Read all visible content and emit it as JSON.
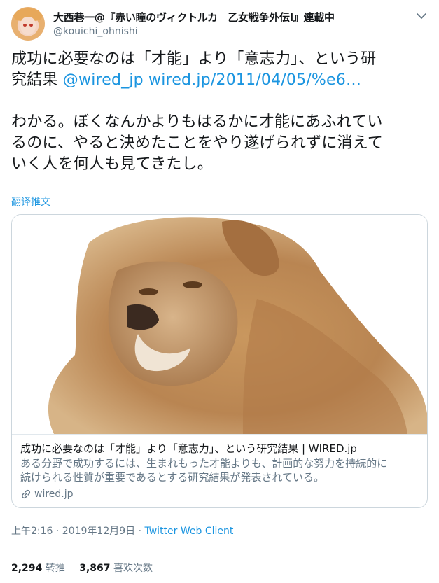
{
  "user": {
    "display_name": "大西巷一@『赤い瞳のヴィクトルカ　乙女戦争外伝Ⅰ』連載中",
    "handle": "@kouichi_ohnishi"
  },
  "tweet": {
    "line1": "成功に必要なのは「才能」より「意志力」、という研",
    "line2_text": "究結果 ",
    "mention": "@wired_jp",
    "url": "wired.jp/2011/04/05/%e6…",
    "body_line1": "わかる。ぼくなんかよりもはるかに才能にあふれてい",
    "body_line2": "るのに、やると決めたことをやり遂げられずに消えて",
    "body_line3": "いく人を何人も見てきたし。"
  },
  "translate_label": "翻译推文",
  "card": {
    "title": "成功に必要なのは「才能」より「意志力」、という研究結果 | WIRED.jp",
    "description_line1": "ある分野で成功するには、生まれもった才能よりも、計画的な努力を持続的に",
    "description_line2": "続けられる性質が重要であるとする研究結果が発表されている。",
    "domain": "wired.jp"
  },
  "meta": {
    "timestamp": "上午2:16 · 2019年12月9日 · ",
    "client": "Twitter Web Client"
  },
  "stats": {
    "retweets_count": "2,294",
    "retweets_label": "转推",
    "likes_count": "3,867",
    "likes_label": "喜欢次数"
  },
  "icons": {
    "chevron": "chevron-down-icon",
    "link": "link-icon",
    "avatar": "avatar"
  }
}
